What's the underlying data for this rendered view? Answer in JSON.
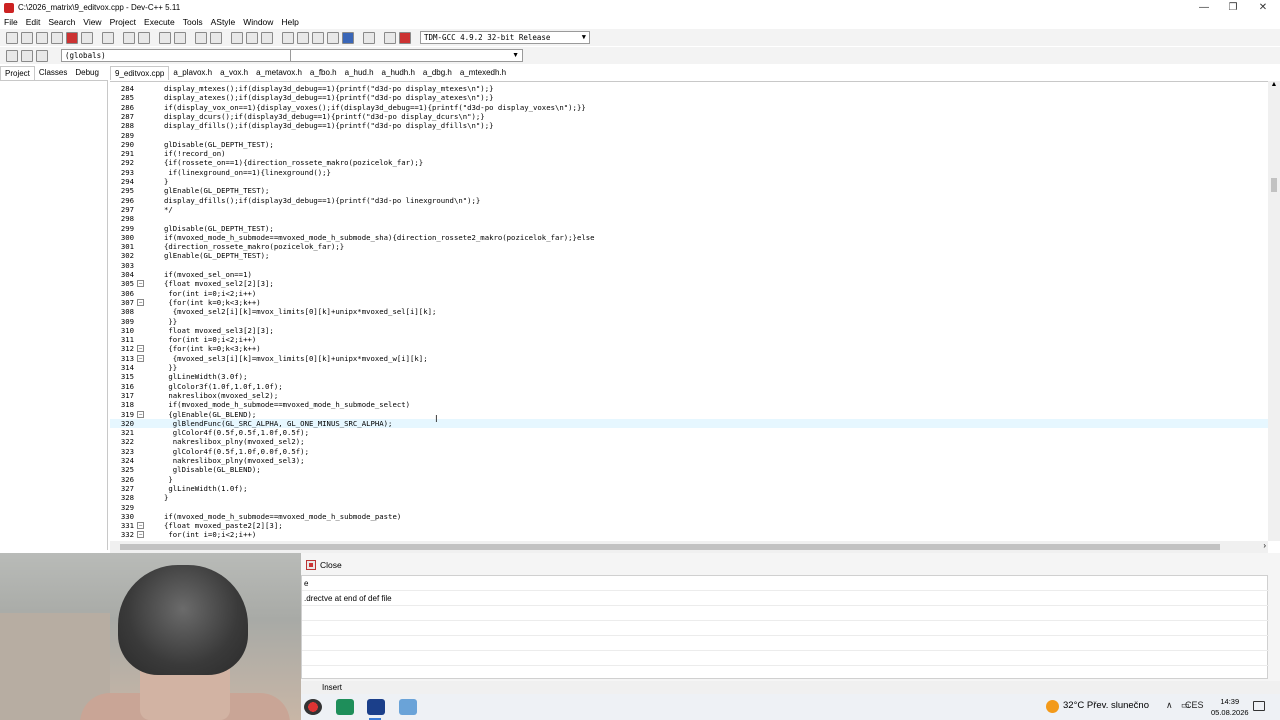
{
  "window": {
    "title": "C:\\2026_matrix\\9_editvox.cpp - Dev-C++ 5.11"
  },
  "window_controls": {
    "minimize": "—",
    "restore": "❐",
    "close": "✕"
  },
  "menu": [
    "File",
    "Edit",
    "Search",
    "View",
    "Project",
    "Execute",
    "Tools",
    "AStyle",
    "Window",
    "Help"
  ],
  "toolbar": {
    "compiler": "TDM-GCC 4.9.2 32-bit Release",
    "scope": "(globals)"
  },
  "left_tabs": [
    "Project",
    "Classes",
    "Debug"
  ],
  "file_tabs": [
    "9_editvox.cpp",
    "a_plavox.h",
    "a_vox.h",
    "a_metavox.h",
    "a_fbo.h",
    "a_hud.h",
    "a_hudh.h",
    "a_dbg.h",
    "a_mtexedh.h"
  ],
  "editor": {
    "current_line": 320,
    "lines": [
      {
        "n": "284",
        "code": "display_mtexes();if(display3d_debug==1){printf(\"d3d-po display_mtexes\\n\");}",
        "fold": ""
      },
      {
        "n": "285",
        "code": "display_atexes();if(display3d_debug==1){printf(\"d3d-po display_atexes\\n\");}",
        "fold": ""
      },
      {
        "n": "286",
        "code": "if(display_vox_on==1){display_voxes();if(display3d_debug==1){printf(\"d3d-po display_voxes\\n\");}}",
        "fold": ""
      },
      {
        "n": "287",
        "code": "display_dcurs();if(display3d_debug==1){printf(\"d3d-po display_dcurs\\n\");}",
        "fold": ""
      },
      {
        "n": "288",
        "code": "display_dfills();if(display3d_debug==1){printf(\"d3d-po display_dfills\\n\");}",
        "fold": ""
      },
      {
        "n": "289",
        "code": "",
        "fold": ""
      },
      {
        "n": "290",
        "code": "glDisable(GL_DEPTH_TEST);",
        "fold": ""
      },
      {
        "n": "291",
        "code": "if(!record_on)",
        "fold": ""
      },
      {
        "n": "292",
        "code": "{if(rossete_on==1){direction_rossete_makro(pozicelok_far);}",
        "fold": ""
      },
      {
        "n": "293",
        "code": " if(linexground_on==1){linexground();}",
        "fold": ""
      },
      {
        "n": "294",
        "code": "}",
        "fold": ""
      },
      {
        "n": "295",
        "code": "glEnable(GL_DEPTH_TEST);",
        "fold": ""
      },
      {
        "n": "296",
        "code": "display_dfills();if(display3d_debug==1){printf(\"d3d-po linexground\\n\");}",
        "fold": ""
      },
      {
        "n": "297",
        "code": "*/",
        "fold": ""
      },
      {
        "n": "298",
        "code": "",
        "fold": ""
      },
      {
        "n": "299",
        "code": "glDisable(GL_DEPTH_TEST);",
        "fold": ""
      },
      {
        "n": "300",
        "code": "if(mvoxed_mode_h_submode==mvoxed_mode_h_submode_sha){direction_rossete2_makro(pozicelok_far);}else",
        "fold": ""
      },
      {
        "n": "301",
        "code": "{direction_rossete_makro(pozicelok_far);}",
        "fold": ""
      },
      {
        "n": "302",
        "code": "glEnable(GL_DEPTH_TEST);",
        "fold": ""
      },
      {
        "n": "303",
        "code": "",
        "fold": ""
      },
      {
        "n": "304",
        "code": "if(mvoxed_sel_on==1)",
        "fold": ""
      },
      {
        "n": "305",
        "code": "{float mvoxed_sel2[2][3];",
        "fold": "−"
      },
      {
        "n": "306",
        "code": " for(int i=0;i<2;i++)",
        "fold": ""
      },
      {
        "n": "307",
        "code": " {for(int k=0;k<3;k++)",
        "fold": "−"
      },
      {
        "n": "308",
        "code": "  {mvoxed_sel2[i][k]=mvox_limits[0][k]+unipx*mvoxed_sel[i][k];",
        "fold": ""
      },
      {
        "n": "309",
        "code": " }}",
        "fold": ""
      },
      {
        "n": "310",
        "code": " float mvoxed_sel3[2][3];",
        "fold": ""
      },
      {
        "n": "311",
        "code": " for(int i=0;i<2;i++)",
        "fold": ""
      },
      {
        "n": "312",
        "code": " {for(int k=0;k<3;k++)",
        "fold": "−"
      },
      {
        "n": "313",
        "code": "  {mvoxed_sel3[i][k]=mvox_limits[0][k]+unipx*mvoxed_w[i][k];",
        "fold": "−"
      },
      {
        "n": "314",
        "code": " }}",
        "fold": ""
      },
      {
        "n": "315",
        "code": " glLineWidth(3.0f);",
        "fold": ""
      },
      {
        "n": "316",
        "code": " glColor3f(1.0f,1.0f,1.0f);",
        "fold": ""
      },
      {
        "n": "317",
        "code": " nakreslibox(mvoxed_sel2);",
        "fold": ""
      },
      {
        "n": "318",
        "code": " if(mvoxed_mode_h_submode==mvoxed_mode_h_submode_select)",
        "fold": ""
      },
      {
        "n": "319",
        "code": " {glEnable(GL_BLEND);",
        "fold": "−"
      },
      {
        "n": "320",
        "code": "  glBlendFunc(GL_SRC_ALPHA, GL_ONE_MINUS_SRC_ALPHA);",
        "fold": ""
      },
      {
        "n": "321",
        "code": "  glColor4f(0.5f,0.5f,1.0f,0.5f);",
        "fold": ""
      },
      {
        "n": "322",
        "code": "  nakreslibox_plny(mvoxed_sel2);",
        "fold": ""
      },
      {
        "n": "323",
        "code": "  glColor4f(0.5f,1.0f,0.0f,0.5f);",
        "fold": ""
      },
      {
        "n": "324",
        "code": "  nakreslibox_plny(mvoxed_sel3);",
        "fold": ""
      },
      {
        "n": "325",
        "code": "  glDisable(GL_BLEND);",
        "fold": ""
      },
      {
        "n": "326",
        "code": " }",
        "fold": ""
      },
      {
        "n": "327",
        "code": " glLineWidth(1.0f);",
        "fold": ""
      },
      {
        "n": "328",
        "code": "}",
        "fold": ""
      },
      {
        "n": "329",
        "code": "",
        "fold": ""
      },
      {
        "n": "330",
        "code": "if(mvoxed_mode_h_submode==mvoxed_mode_h_submode_paste)",
        "fold": ""
      },
      {
        "n": "331",
        "code": "{float mvoxed_paste2[2][3];",
        "fold": "−"
      },
      {
        "n": "332",
        "code": " for(int i=0;i<2;i++)",
        "fold": "−"
      }
    ]
  },
  "bottom": {
    "close_label": "Close",
    "output_rows": [
      "e",
      ".drectve at end of def file"
    ]
  },
  "status": {
    "mode": "Insert"
  },
  "taskbar": {
    "weather": "32°C  Přev. slunečno",
    "language": "CES",
    "time": "14:39",
    "date": "05.08.2026",
    "chevron": "∧"
  }
}
